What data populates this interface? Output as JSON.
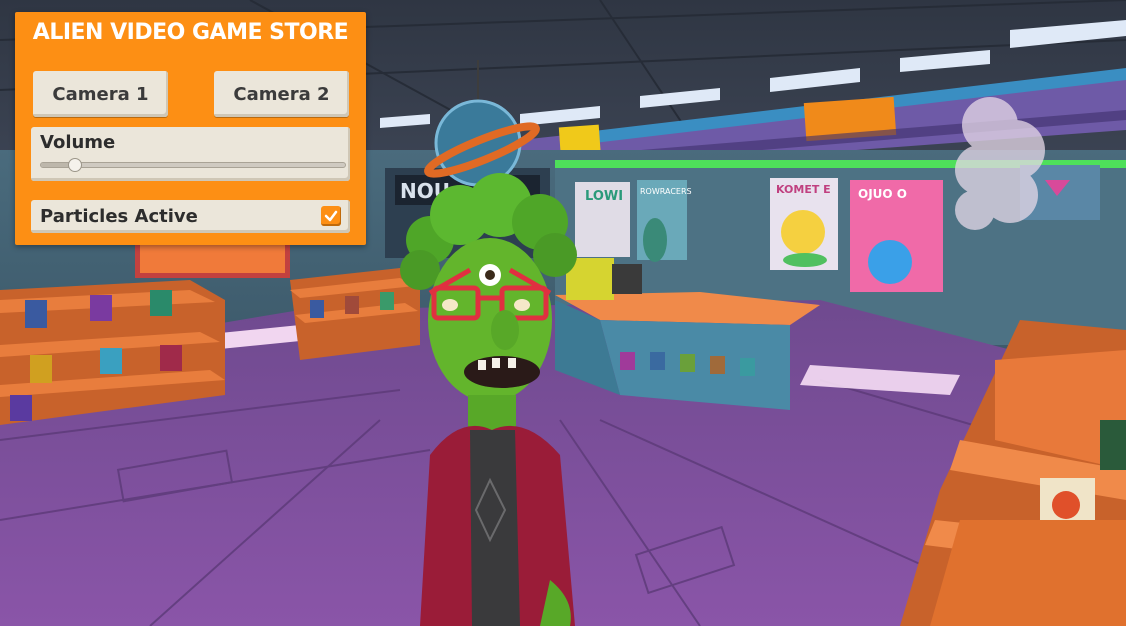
{
  "ui_panel": {
    "title": "ALIEN VIDEO GAME STORE",
    "camera1_label": "Camera 1",
    "camera2_label": "Camera 2",
    "volume": {
      "label": "Volume",
      "value": 0.11
    },
    "particles": {
      "label": "Particles Active",
      "checked": true
    }
  },
  "scene": {
    "description_icons": [
      "alien-character",
      "game-shelf",
      "checkout-counter",
      "posters"
    ],
    "poster_texts": [
      "LOWI",
      "ROWRACERS",
      "KOMET E",
      "OJUO O"
    ]
  },
  "colors": {
    "panel_orange": "#fd8f14",
    "card_bg": "#ebe6da",
    "floor_purple": "#7a4a99",
    "alien_green": "#5fb52a",
    "jacket_red": "#9a1c38"
  }
}
